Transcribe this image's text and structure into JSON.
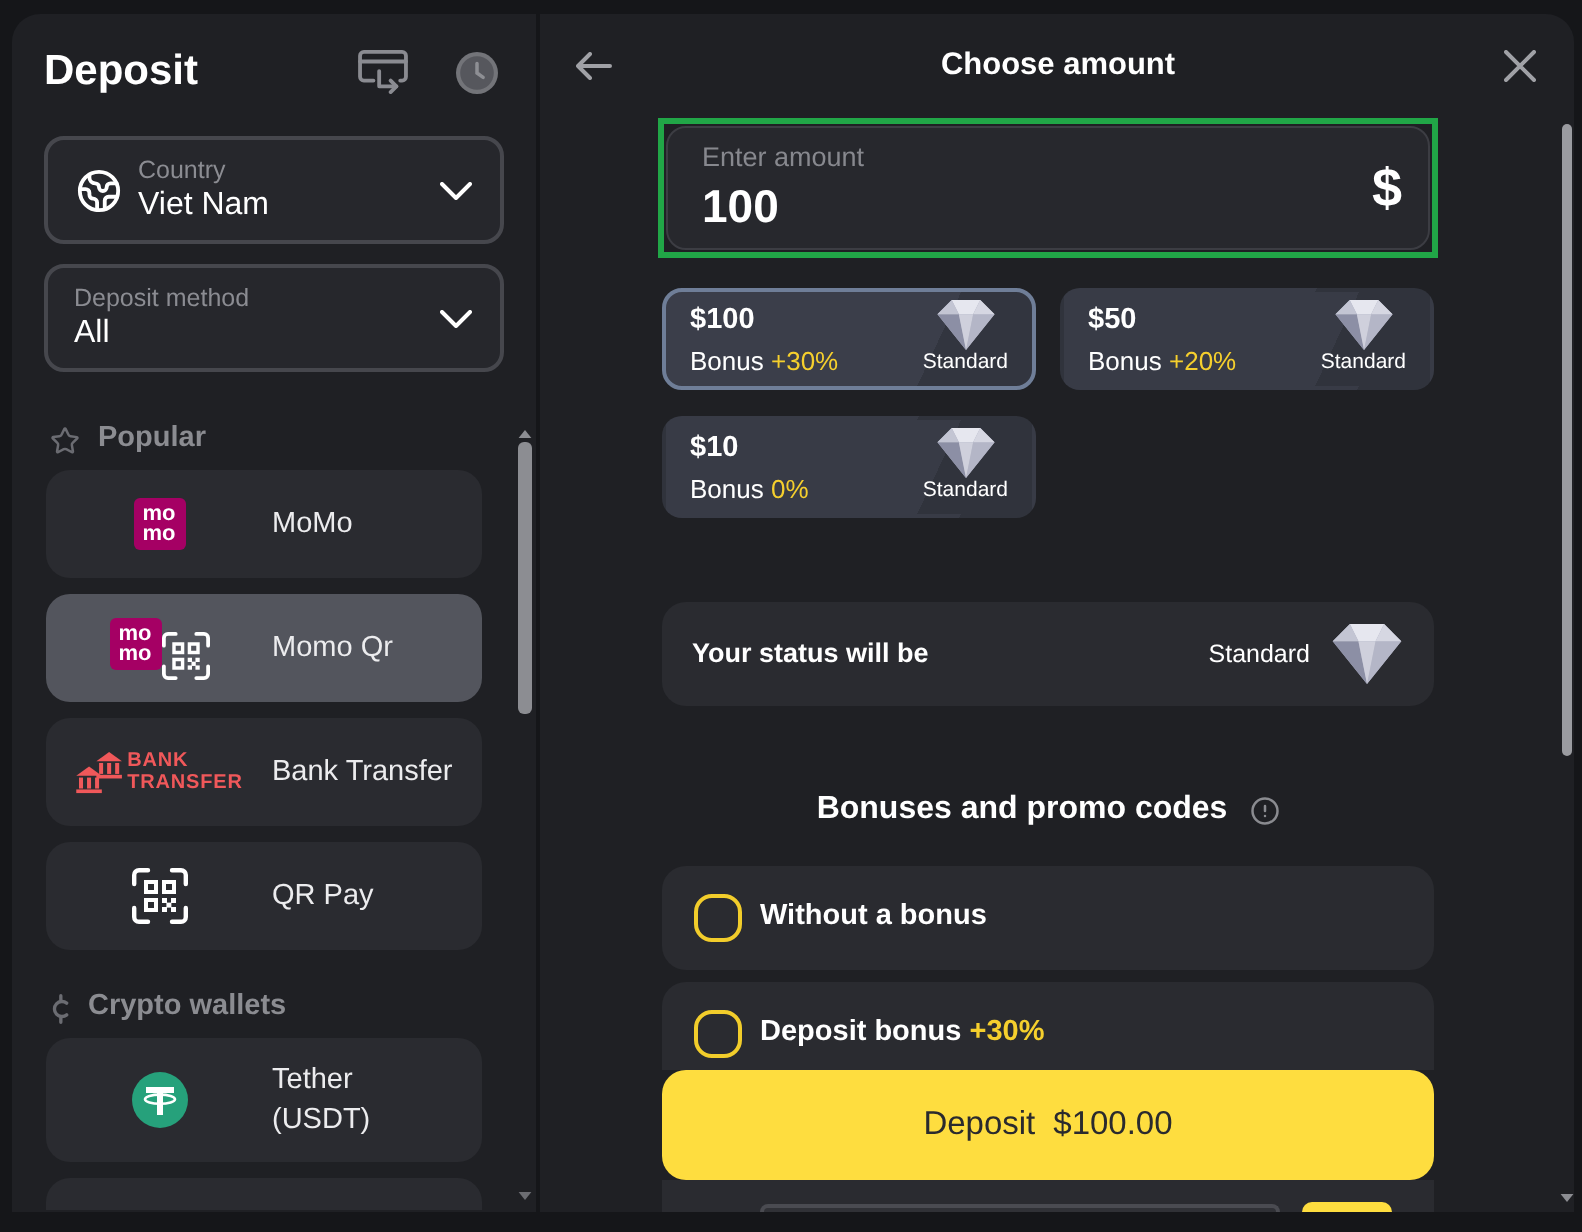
{
  "sidebar": {
    "title": "Deposit",
    "country": {
      "label": "Country",
      "value": "Viet Nam"
    },
    "method": {
      "label": "Deposit method",
      "value": "All"
    },
    "sections": [
      {
        "kind": "popular",
        "title": "Popular",
        "items": [
          {
            "name": "MoMo",
            "kind": "momo",
            "logo_text": [
              "mo",
              "mo"
            ],
            "selected": false
          },
          {
            "name": "Momo Qr",
            "kind": "momo_qr",
            "logo_text": [
              "mo",
              "mo"
            ],
            "selected": true
          },
          {
            "name": "Bank Transfer",
            "kind": "bank",
            "logo_text": [
              "BANK",
              "TRANSFER"
            ],
            "selected": false
          },
          {
            "name": "QR Pay",
            "kind": "qr",
            "selected": false
          }
        ]
      },
      {
        "kind": "crypto",
        "title": "Crypto wallets",
        "items": [
          {
            "name": "Tether (USDT)",
            "kind": "tether",
            "selected": false
          }
        ]
      }
    ],
    "more_below": true
  },
  "main": {
    "title": "Choose amount",
    "amount_field": {
      "label": "Enter amount",
      "value": "100",
      "currency": "$",
      "highlighted": true
    },
    "presets": [
      {
        "amount": "$100",
        "bonus_label": "Bonus",
        "bonus": "+30%",
        "tier": "Standard",
        "selected": true
      },
      {
        "amount": "$50",
        "bonus_label": "Bonus",
        "bonus": "+20%",
        "tier": "Standard",
        "selected": false
      },
      {
        "amount": "$10",
        "bonus_label": "Bonus",
        "bonus": "0%",
        "tier": "Standard",
        "selected": false
      }
    ],
    "status": {
      "label": "Your status will be",
      "tier": "Standard"
    },
    "bonuses": {
      "title": "Bonuses and promo codes",
      "options": [
        {
          "label": "Without a bonus",
          "selected": false,
          "expanded": false
        },
        {
          "label": "Deposit bonus",
          "highlight": "+30%",
          "selected": false,
          "expanded": true
        }
      ]
    },
    "deposit_button": {
      "label": "Deposit",
      "amount": "$100.00"
    }
  }
}
